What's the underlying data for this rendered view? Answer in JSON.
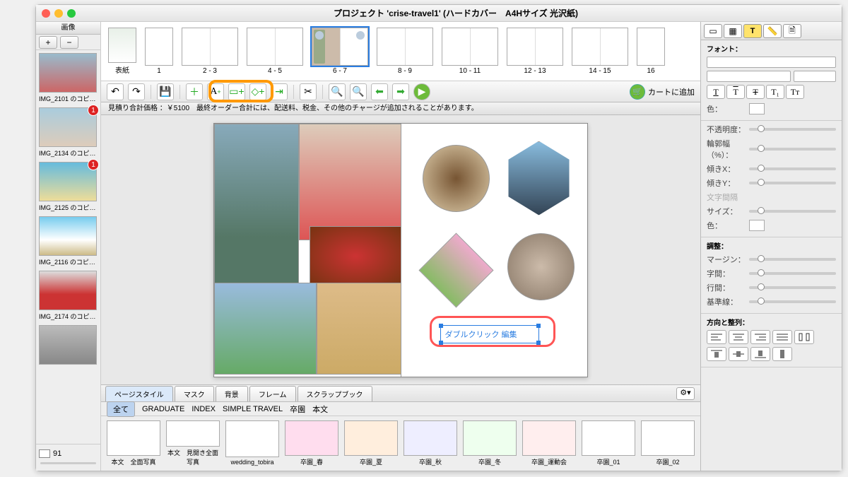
{
  "window": {
    "title": "プロジェクト 'crise-travel1' (ハードカバー　A4Hサイズ 光沢紙)"
  },
  "left_panel": {
    "header": "画像",
    "add": "+",
    "remove": "−",
    "count_label": "91",
    "thumbs": [
      {
        "label": "IMG_2101 のコピー…",
        "badge": ""
      },
      {
        "label": "IMG_2134 のコピー…",
        "badge": "1"
      },
      {
        "label": "IMG_2125 のコピー…",
        "badge": "1"
      },
      {
        "label": "IMG_2116 のコピー-j…",
        "badge": ""
      },
      {
        "label": "IMG_2174 のコピー…",
        "badge": ""
      },
      {
        "label": "",
        "badge": ""
      }
    ]
  },
  "pages": [
    {
      "label": "表紙",
      "single": true
    },
    {
      "label": "1",
      "single": true
    },
    {
      "label": "2 - 3"
    },
    {
      "label": "4 - 5"
    },
    {
      "label": "6 - 7",
      "selected": true
    },
    {
      "label": "8 - 9"
    },
    {
      "label": "10 - 11"
    },
    {
      "label": "12 - 13"
    },
    {
      "label": "14 - 15"
    },
    {
      "label": "16",
      "single": true
    }
  ],
  "toolbar": {
    "cart_label": "カートに追加"
  },
  "price_line": "見積り合計価格 ：￥5100　最終オーダー合計には、配送料、税金、その他のチャージが追加されることがあります。",
  "canvas": {
    "textbox": "ダブルクリック 編集"
  },
  "bottom": {
    "tabs": [
      "ページスタイル",
      "マスク",
      "背景",
      "フレーム",
      "スクラップブック"
    ],
    "gear": "⚙",
    "filters_all": "全て",
    "filters": [
      "GRADUATE",
      "INDEX",
      "SIMPLE TRAVEL",
      "卒園",
      "本文"
    ],
    "styles": [
      "本文　全面写真",
      "本文　見開き全面写真",
      "wedding_tobira",
      "卒園_春",
      "卒園_夏",
      "卒園_秋",
      "卒園_冬",
      "卒園_運動会",
      "卒園_01",
      "卒園_02"
    ]
  },
  "inspector": {
    "section_font": "フォント：",
    "label_color": "色：",
    "label_opacity": "不透明度：",
    "label_outline": "輪郭幅（%）：",
    "label_skewx": "傾きX：",
    "label_skewy": "傾きY：",
    "label_kerning": "文字間隔",
    "label_size": "サイズ：",
    "label_color2": "色：",
    "section_adjust": "調整：",
    "label_margin": "マージン：",
    "label_spacing": "字間：",
    "label_line": "行間：",
    "label_baseline": "基準線：",
    "section_align": "方向と整列：",
    "style_buttons": [
      "T",
      "T",
      "T",
      "T₁",
      "Tᴛ"
    ]
  }
}
